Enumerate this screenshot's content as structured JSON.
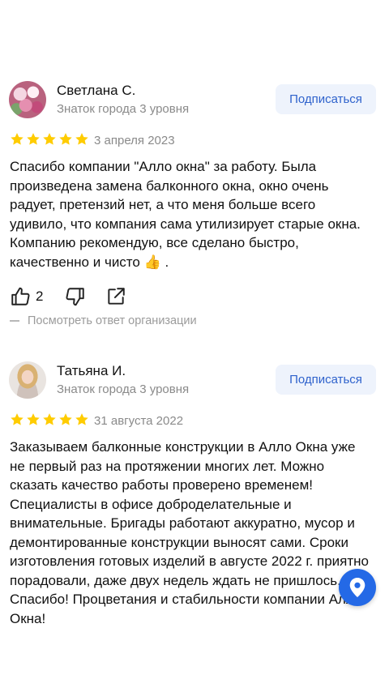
{
  "subscribe_label": "Подписаться",
  "reviews": [
    {
      "author": "Светлана С.",
      "level": "Знаток города 3 уровня",
      "rating": 5,
      "date": "3 апреля 2023",
      "text": "Спасибо компании \"Алло окна\" за работу. Была произведена замена балконного окна, окно очень радует, претензий нет, а что меня больше всего удивило, что компания сама утилизирует старые окна. Компанию рекомендую, все сделано быстро, качественно и чисто 👍 .",
      "likes": "2",
      "org_reply_link": "Посмотреть ответ организации"
    },
    {
      "author": "Татьяна И.",
      "level": "Знаток города 3 уровня",
      "rating": 5,
      "date": "31 августа 2022",
      "text": "Заказываем балконные конструкции в Алло Окна уже не первый раз на протяжении многих лет. Можно сказать качество работы проверено временем! Специалисты в офисе доброделательные и внимательные. Бригады работают аккуратно, мусор и демонтированные конструкции выносят сами. Сроки изготовления готовых изделий в августе 2022 г. приятно порадовали, даже двух недель ждать не пришлось. Спасибо! Процветания и стабильности компании Алло Окна!"
    }
  ],
  "colors": {
    "star": "#fc0",
    "accent": "#2e62cc",
    "fab": "#2469e6"
  },
  "icons": [
    "like-icon",
    "dislike-icon",
    "share-icon",
    "map-pin-icon",
    "star-icon"
  ]
}
